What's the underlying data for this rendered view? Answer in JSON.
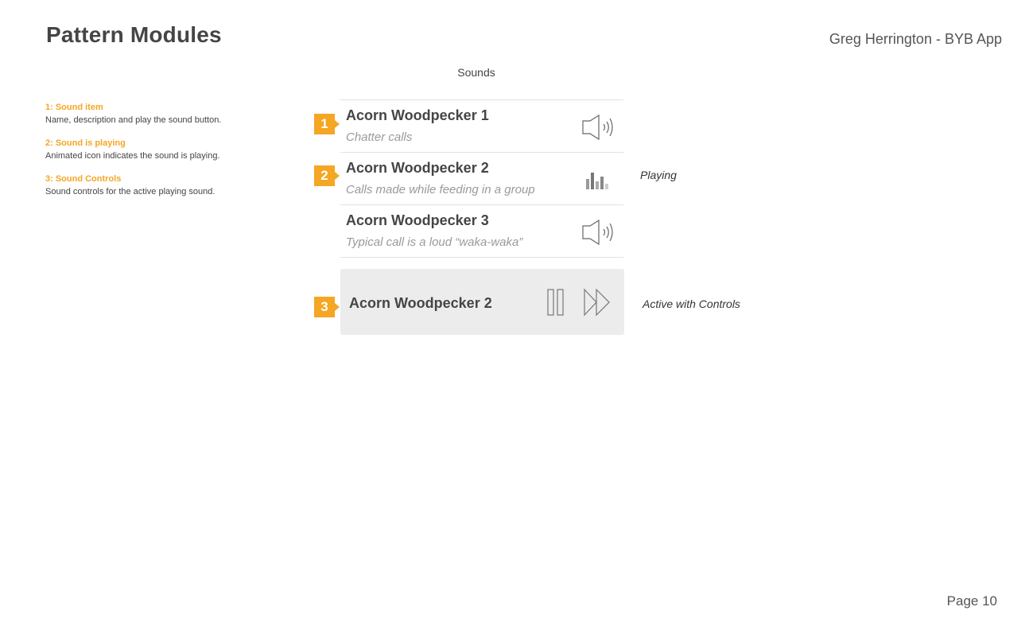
{
  "header": {
    "title": "Pattern Modules",
    "author": "Greg Herrington - BYB App"
  },
  "screen": {
    "title": "Sounds"
  },
  "legend": [
    {
      "heading": "1: Sound item",
      "description": "Name, description and play the sound button."
    },
    {
      "heading": "2: Sound is playing",
      "description": "Animated icon indicates the sound is playing."
    },
    {
      "heading": "3: Sound Controls",
      "description": "Sound controls for the active playing sound."
    }
  ],
  "markers": [
    "1",
    "2",
    "3"
  ],
  "sounds": [
    {
      "name": "Acorn Woodpecker 1",
      "description": "Chatter calls",
      "icon": "speaker-icon"
    },
    {
      "name": "Acorn Woodpecker 2",
      "description": "Calls made while feeding in a group",
      "icon": "equalizer-icon"
    },
    {
      "name": "Acorn Woodpecker 3",
      "description": "Typical call is a loud “waka-waka”",
      "icon": "speaker-icon"
    }
  ],
  "notes": {
    "playing": "Playing",
    "active": "Active with Controls"
  },
  "player": {
    "name": "Acorn Woodpecker 2",
    "pause_icon": "pause-icon",
    "forward_icon": "fast-forward-icon"
  },
  "footer": {
    "page": "Page 10"
  },
  "colors": {
    "accent": "#f5a623",
    "text": "#454545",
    "muted": "#9a9a9a",
    "player_bg": "#ececec"
  }
}
